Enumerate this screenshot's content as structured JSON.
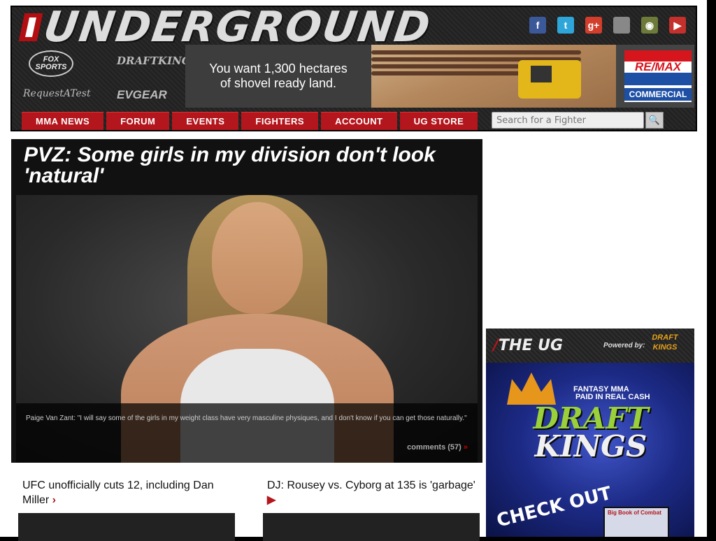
{
  "site": {
    "logo_text": "UNDERGROUND"
  },
  "social": {
    "items": [
      "facebook",
      "twitter",
      "google-plus",
      "apple",
      "android",
      "youtube"
    ]
  },
  "sponsors": {
    "fox": "FOX SPORTS",
    "draftkings": "DRAFTKINGS",
    "requestatest": "RequestATest",
    "evgear": "EVGEAR"
  },
  "ad": {
    "text_line1": "You want 1,300 hectares",
    "text_line2": "of shovel ready land.",
    "brand": "RE/MAX",
    "brand_sub": "COMMERCIAL"
  },
  "nav": {
    "items": [
      "MMA NEWS",
      "FORUM",
      "EVENTS",
      "FIGHTERS",
      "ACCOUNT",
      "UG STORE"
    ]
  },
  "search": {
    "placeholder": "Search for a Fighter"
  },
  "main_story": {
    "title": "PVZ: Some girls in my division don't look 'natural'",
    "caption": "Paige Van Zant: \"I will say some of the girls in my weight class have very masculine physiques, and I don't know if you can get those naturally.\"",
    "comments": "comments (57)",
    "comments_arrow": "»"
  },
  "sub_stories": [
    {
      "title": "UFC unofficially cuts 12, including Dan Miller",
      "arrow": "›"
    },
    {
      "title": "DJ: Rousey vs. Cyborg at 135 is 'garbage'",
      "arrow": "▶"
    }
  ],
  "rail": {
    "logo": "THE UG",
    "powered_by": "Powered by:",
    "powered_brand_line1": "DRAFT",
    "powered_brand_line2": "KINGS",
    "ad_line1": "FANTASY MMA",
    "ad_line2": "PAID IN REAL CASH",
    "ad_brand_line1": "DRAFT",
    "ad_brand_line2": "KINGS",
    "ad_cta": "CHECK OUT",
    "book_title": "Big Book of Combat"
  },
  "colors": {
    "accent": "#b3161c",
    "header_bg": "#252525"
  }
}
